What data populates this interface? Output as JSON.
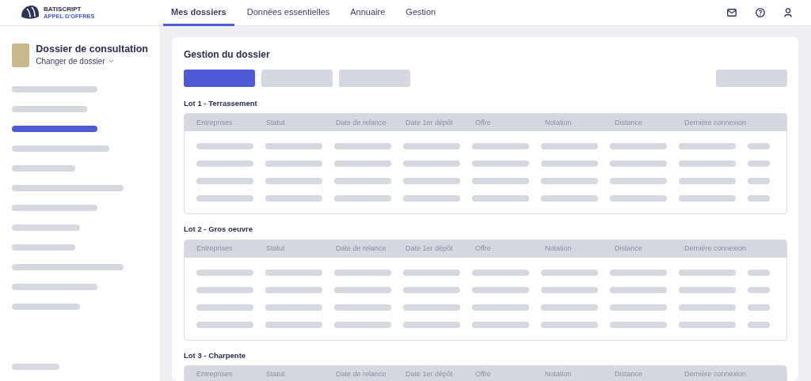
{
  "brand": {
    "name": "BATISCRIPT",
    "tagline": "APPEL D'OFFRES"
  },
  "nav": [
    {
      "label": "Mes dossiers",
      "selected": true
    },
    {
      "label": "Données essentielles",
      "selected": false
    },
    {
      "label": "Annuaire",
      "selected": false
    },
    {
      "label": "Gestion",
      "selected": false
    }
  ],
  "sidebar": {
    "title": "Dossier de consultation",
    "switch_label": "Changer de dossier",
    "items": [
      {
        "selected": false
      },
      {
        "selected": false
      },
      {
        "selected": true
      },
      {
        "selected": false
      },
      {
        "selected": false
      },
      {
        "selected": false
      },
      {
        "selected": false
      },
      {
        "selected": false
      },
      {
        "selected": false
      },
      {
        "selected": false
      },
      {
        "selected": false
      },
      {
        "selected": false
      }
    ]
  },
  "main": {
    "title": "Gestion du dossier",
    "actions": [
      {
        "selected": true
      },
      {
        "selected": false
      },
      {
        "selected": false
      }
    ],
    "lots": [
      {
        "title": "Lot 1 - Terrassement",
        "columns": [
          "Entreprises",
          "Statut",
          "Date de relance",
          "Date 1er dépôt",
          "Offre",
          "Notation",
          "Distance",
          "Dernière connexion"
        ],
        "rows": [
          {
            "loading": true
          },
          {
            "loading": true
          },
          {
            "loading": true
          },
          {
            "loading": true
          }
        ]
      },
      {
        "title": "Lot 2 - Gros oeuvre",
        "columns": [
          "Entreprises",
          "Statut",
          "Date de relance",
          "Date 1er dépôt",
          "Offre",
          "Notation",
          "Distance",
          "Dernière connexion"
        ],
        "rows": [
          {
            "loading": true
          },
          {
            "loading": true
          },
          {
            "loading": true
          },
          {
            "loading": true
          }
        ]
      },
      {
        "title": "Lot 3 - Charpente",
        "columns": [
          "Entreprises",
          "Statut",
          "Date de relance",
          "Date 1er dépôt",
          "Offre",
          "Notation",
          "Distance",
          "Dernière connexion"
        ]
      }
    ]
  }
}
